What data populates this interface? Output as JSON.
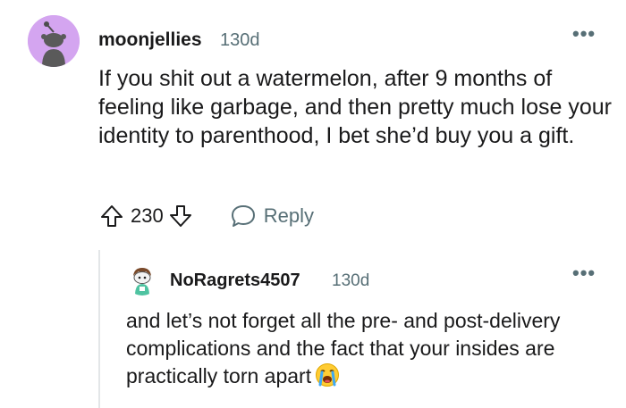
{
  "comments": [
    {
      "author": "moonjellies",
      "age": "130d",
      "more_label": "•••",
      "body": "If you shit out a watermelon, after 9 months of feeling like garbage, and then pretty much lose your identity to parenthood, I bet she’d buy you a gift.",
      "score": "230",
      "reply_label": "Reply",
      "avatar_color": "#d4a5f0"
    },
    {
      "author": "NoRagrets4507",
      "age": "130d",
      "more_label": "•••",
      "body": "and let’s not forget all the pre- and post-delivery complications and the fact that your insides are practically torn apart",
      "emoji": "loudly-crying-face-emoji"
    }
  ],
  "colors": {
    "text": "#1a1a1b",
    "meta": "#576f76",
    "thread_line": "#e3e6e8"
  }
}
